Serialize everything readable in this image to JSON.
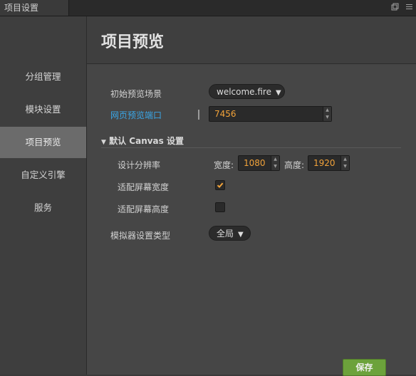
{
  "window": {
    "tab_title": "项目设置",
    "icons": [
      "popout-icon",
      "menu-icon"
    ]
  },
  "sidebar": {
    "items": [
      {
        "label": "分组管理",
        "active": false
      },
      {
        "label": "模块设置",
        "active": false
      },
      {
        "label": "项目预览",
        "active": true
      },
      {
        "label": "自定义引擎",
        "active": false
      },
      {
        "label": "服务",
        "active": false
      }
    ]
  },
  "main": {
    "title": "项目预览",
    "start_scene": {
      "label": "初始预览场景",
      "value": "welcome.fire"
    },
    "preview_port": {
      "label": "网页预览端口",
      "value": "7456"
    },
    "canvas_section": {
      "title": "默认 Canvas 设置",
      "design_resolution": {
        "label": "设计分辨率",
        "width_label": "宽度:",
        "width_value": "1080",
        "height_label": "高度:",
        "height_value": "1920"
      },
      "fit_width": {
        "label": "适配屏幕宽度",
        "checked": true
      },
      "fit_height": {
        "label": "适配屏幕高度",
        "checked": false
      }
    },
    "simulator": {
      "label": "模拟器设置类型",
      "value": "全局"
    },
    "save_label": "保存"
  },
  "colors": {
    "accent_link": "#3aa7e8",
    "value_orange": "#f2a33a",
    "save_green": "#6ca23b",
    "check_orange": "#f2a33a"
  }
}
